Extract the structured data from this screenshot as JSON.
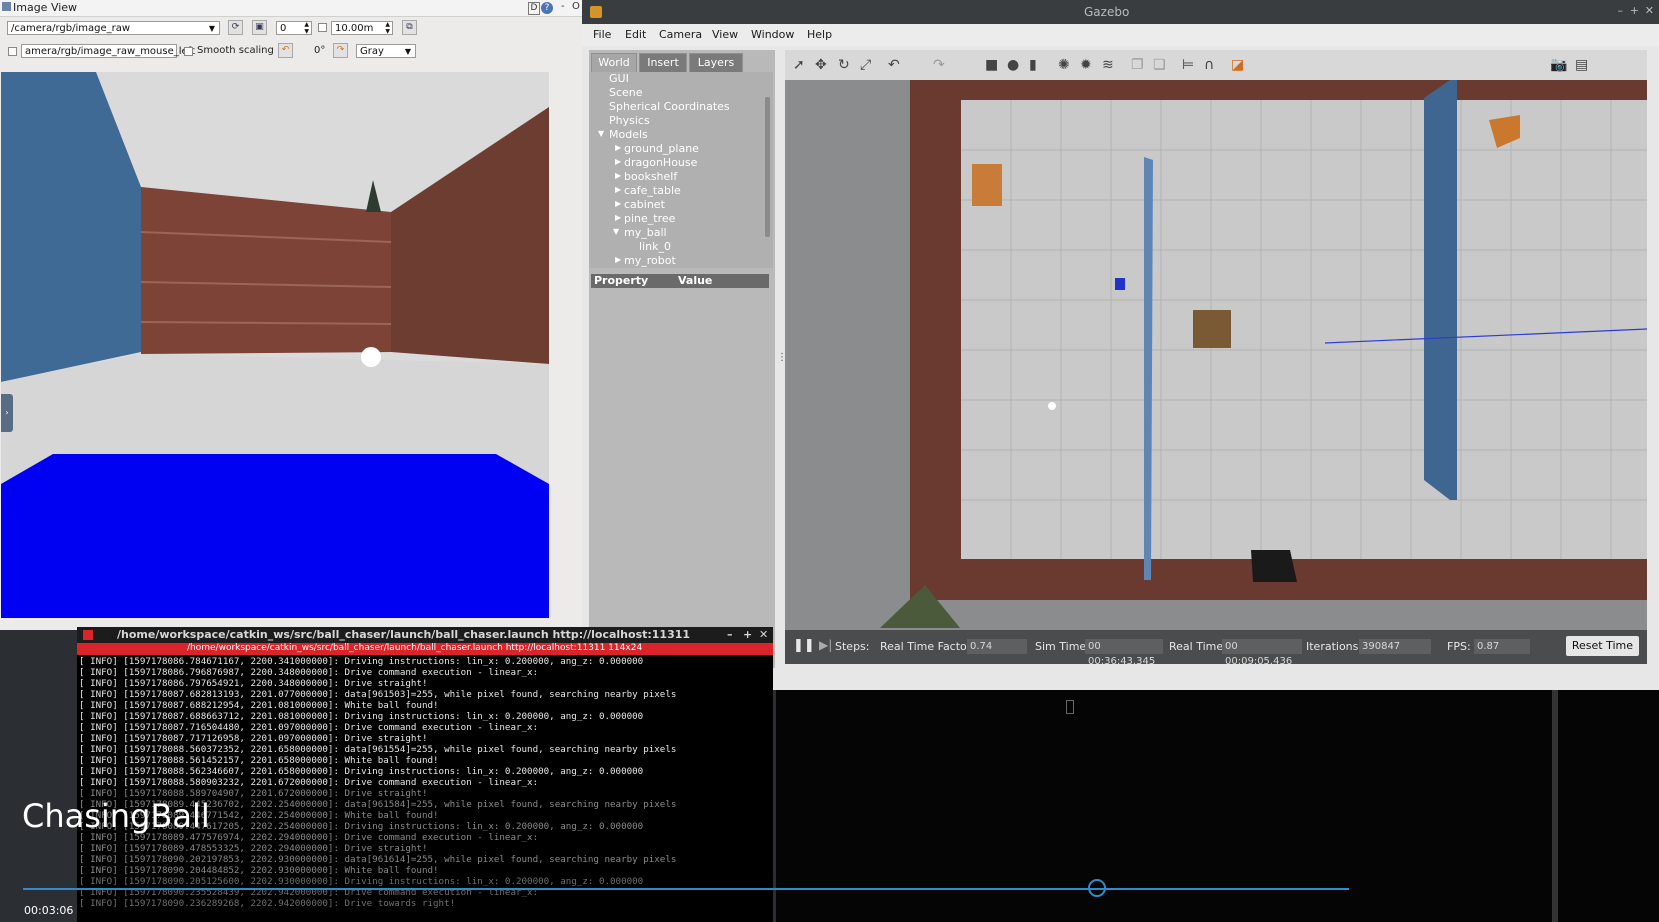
{
  "image_view": {
    "title": "Image View",
    "topic": "/camera/rgb/image_raw",
    "spin_value": "0",
    "distance": "10.00m",
    "mouse_topic": "amera/rgb/image_raw_mouse_left",
    "smooth_label": "Smooth scaling",
    "rotation": "0°",
    "color_scheme": "Gray",
    "title_ctl": "D",
    "title_ctl2": "O"
  },
  "gazebo": {
    "title": "Gazebo",
    "menu": [
      "File",
      "Edit",
      "Camera",
      "View",
      "Window",
      "Help"
    ],
    "tabs": [
      "World",
      "Insert",
      "Layers"
    ],
    "tree": {
      "gui": "GUI",
      "scene": "Scene",
      "spherical": "Spherical Coordinates",
      "physics": "Physics",
      "models": "Models",
      "items": [
        "ground_plane",
        "dragonHouse",
        "bookshelf",
        "cafe_table",
        "cabinet",
        "pine_tree",
        "my_ball"
      ],
      "link": "link_0",
      "robot": "my_robot"
    },
    "props_header": {
      "property": "Property",
      "value": "Value"
    },
    "status": {
      "steps_label": "Steps:",
      "rtf_label": "Real Time Factor:",
      "rtf": "0.74",
      "sim_label": "Sim Time:",
      "sim": "00 00:36:43.345",
      "real_label": "Real Time:",
      "real": "00 00:09:05.436",
      "iter_label": "Iterations:",
      "iter": "390847",
      "fps_label": "FPS:",
      "fps": "0.87",
      "reset": "Reset Time"
    }
  },
  "terminal": {
    "title": "/home/workspace/catkin_ws/src/ball_chaser/launch/ball_chaser.launch http://localhost:11311",
    "tab": "/home/workspace/catkin_ws/src/ball_chaser/launch/ball_chaser.launch http://localhost:11311 114x24",
    "lines": [
      "[ INFO] [1597178086.784671167, 2200.341000000]: Driving instructions: lin_x: 0.200000, ang_z: 0.000000",
      "[ INFO] [1597178086.796876987, 2200.348000000]: Drive command execution - linear_x:",
      "[ INFO] [1597178086.797654921, 2200.348000000]: Drive straight!",
      "[ INFO] [1597178087.682813193, 2201.077000000]: data[961503]=255, while pixel found, searching nearby pixels",
      "[ INFO] [1597178087.688212954, 2201.081000000]: White ball found!",
      "[ INFO] [1597178087.688663712, 2201.081000000]: Driving instructions: lin_x: 0.200000, ang_z: 0.000000",
      "[ INFO] [1597178087.716504480, 2201.097000000]: Drive command execution - linear_x:",
      "[ INFO] [1597178087.717126958, 2201.097000000]: Drive straight!",
      "[ INFO] [1597178088.560372352, 2201.658000000]: data[961554]=255, while pixel found, searching nearby pixels",
      "[ INFO] [1597178088.561452157, 2201.658000000]: White ball found!",
      "[ INFO] [1597178088.562346607, 2201.658000000]: Driving instructions: lin_x: 0.200000, ang_z: 0.000000",
      "[ INFO] [1597178088.580903232, 2201.672000000]: Drive command execution - linear_x:",
      "[ INFO] [1597178088.589704907, 2201.672000000]: Drive straight!",
      "[ INFO] [1597178089.445236702, 2202.254000000]: data[961584]=255, while pixel found, searching nearby pixels",
      "[ INFO] [1597178089.446771542, 2202.254000000]: White ball found!",
      "[ INFO] [1597178089.447617205, 2202.254000000]: Driving instructions: lin_x: 0.200000, ang_z: 0.000000",
      "[ INFO] [1597178089.477576974, 2202.294000000]: Drive command execution - linear_x:",
      "[ INFO] [1597178089.478553325, 2202.294000000]: Drive straight!",
      "[ INFO] [1597178090.202197853, 2202.930000000]: data[961614]=255, while pixel found, searching nearby pixels",
      "[ INFO] [1597178090.204484852, 2202.930000000]: White ball found!",
      "[ INFO] [1597178090.205125600, 2202.930000000]: Driving instructions: lin_x: 0.200000, ang_z: 0.000000",
      "[ INFO] [1597178090.235528439, 2202.942000000]: Drive command execution - linear_x:",
      "[ INFO] [1597178090.236289268, 2202.942000000]: Drive towards right!"
    ]
  },
  "overlay": {
    "video_title": "ChasingBall",
    "timestamp": "00:03:06",
    "progress": 0.81
  }
}
